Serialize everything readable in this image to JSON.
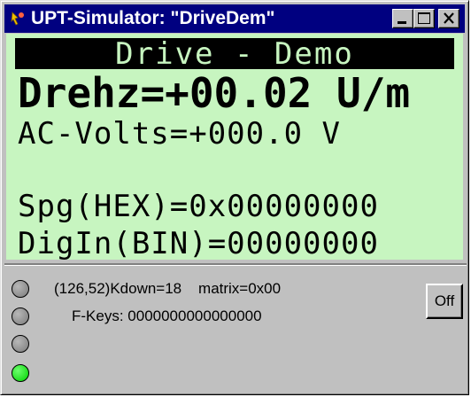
{
  "window": {
    "title": "UPT-Simulator: \"DriveDem\""
  },
  "display": {
    "banner": "Drive - Demo",
    "line1": "Drehz=+00.02 U/m",
    "line2": "AC-Volts=+000.0 V",
    "line3": "",
    "line4": "Spg(HEX)=0x00000000",
    "line5": "DigIn(BIN)=00000000"
  },
  "status": {
    "row1": "(126,52)Kdown=18    matrix=0x00",
    "row2": "F-Keys: 0000000000000000"
  },
  "leds": [
    {
      "state": "off",
      "color": "#8c8c8c"
    },
    {
      "state": "off",
      "color": "#8c8c8c"
    },
    {
      "state": "off",
      "color": "#8c8c8c"
    },
    {
      "state": "on",
      "color": "#00e000"
    }
  ],
  "buttons": {
    "off_label": "Off"
  },
  "colors": {
    "titlebar": "#000080",
    "display_bg": "#c7f5c0",
    "window_bg": "#c0c0c0"
  }
}
